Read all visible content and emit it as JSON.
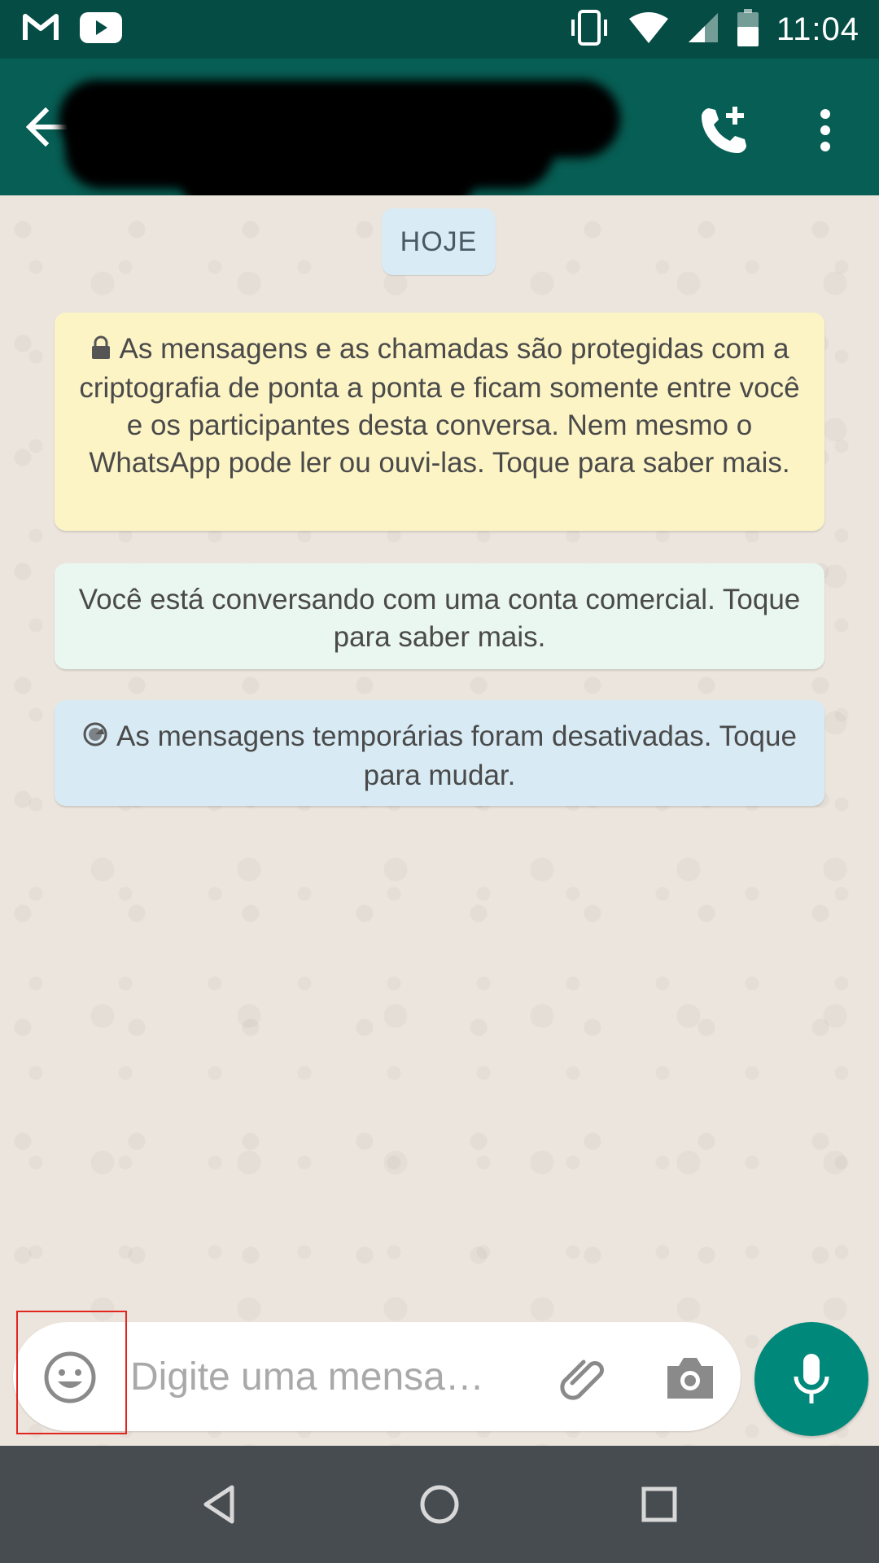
{
  "status_bar": {
    "time": "11:04",
    "icons": [
      "gmail-icon",
      "youtube-icon",
      "vibrate-icon",
      "wifi-icon",
      "signal-icon",
      "battery-icon"
    ]
  },
  "header": {
    "contact_name_redacted": true,
    "background": "#075e54",
    "icons": [
      "back-arrow-icon",
      "add-call-icon",
      "more-vert-icon"
    ]
  },
  "chat": {
    "day_label": "HOJE",
    "encryption_notice": "As mensagens e as chamadas são protegidas com a criptografia de ponta a ponta e ficam somente entre você e os participantes desta conversa. Nem mesmo o WhatsApp pode ler ou ouvi-las. Toque para saber mais.",
    "business_notice": "Você está conversando com uma conta comercial. Toque para saber mais.",
    "temporary_notice": "As mensagens temporárias foram desativadas. Toque para mudar."
  },
  "composer": {
    "placeholder": "Digite uma mensa…",
    "value": "",
    "icons": [
      "emoji-icon",
      "attach-icon",
      "camera-icon",
      "mic-icon"
    ],
    "accent": "#00897b"
  },
  "nav_bar": {
    "icons": [
      "back-triangle-icon",
      "home-circle-icon",
      "recents-square-icon"
    ]
  }
}
